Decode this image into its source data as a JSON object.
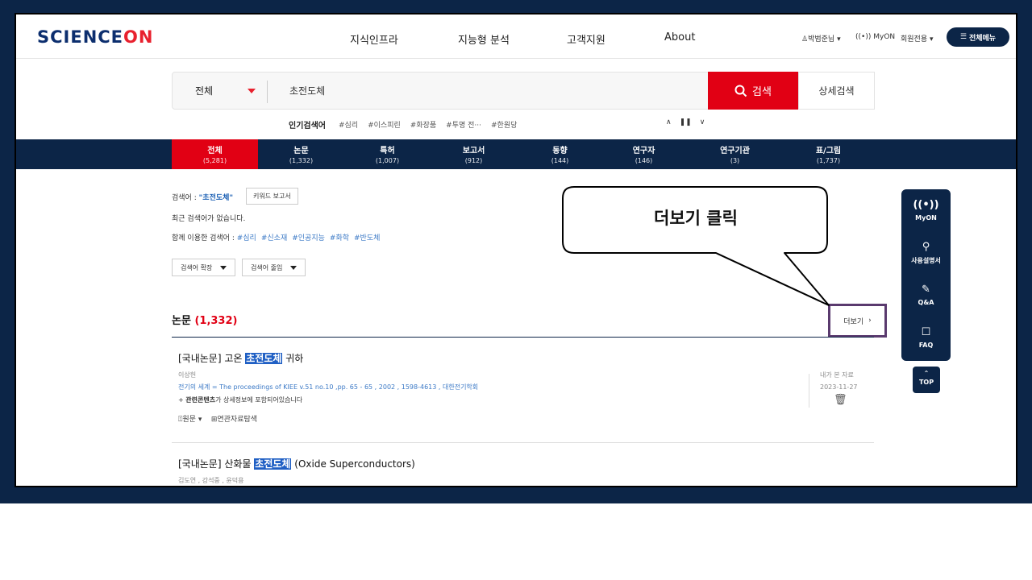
{
  "header": {
    "logo_main": "SCIENCE",
    "logo_accent": "ON",
    "nav": [
      "지식인프라",
      "지능형 분석",
      "고객지원",
      "About"
    ],
    "user": "박범준님",
    "myon": "MyON",
    "member": "회원전용",
    "menu_label": "전체메뉴"
  },
  "search": {
    "scope": "전체",
    "query": "초전도체",
    "search_label": "검색",
    "advanced_label": "상세검색"
  },
  "popular": {
    "label": "인기검색어",
    "items": [
      "#심리",
      "#이스피린",
      "#화장품",
      "#투명 전···",
      "#한원당"
    ],
    "controls": [
      "∧",
      "❚❚",
      "∨"
    ]
  },
  "tabs": [
    {
      "label": "전체",
      "count": "(5,281)"
    },
    {
      "label": "논문",
      "count": "(1,332)"
    },
    {
      "label": "특허",
      "count": "(1,007)"
    },
    {
      "label": "보고서",
      "count": "(912)"
    },
    {
      "label": "동향",
      "count": "(144)"
    },
    {
      "label": "연구자",
      "count": "(146)"
    },
    {
      "label": "연구기관",
      "count": "(3)"
    },
    {
      "label": "표/그림",
      "count": "(1,737)"
    }
  ],
  "info": {
    "keyword_label": "검색어 :",
    "keyword": "\"초전도체\"",
    "keyword_report": "키워드 보고서",
    "recent": "최근 검색어가 없습니다.",
    "related_label": "함께 이용한 검색어 :",
    "related": [
      "#심리",
      "#신소재",
      "#인공지능",
      "#화학",
      "#반도체"
    ],
    "expand": "검색어 확장",
    "narrow": "검색어 줄임"
  },
  "section": {
    "title": "논문",
    "count": "(1,332)",
    "more": "더보기"
  },
  "results": [
    {
      "prefix": "[국내논문] 고온",
      "highlight": "초전도체",
      "suffix": "귀하",
      "author": "이상헌",
      "source": "전기의 세계 = The proceedings of KIEE v.51 no.10 ,pp. 65 - 65 , 2002 , 1598-4613 , 대한전기학회",
      "related_bold": "관련콘텐츠",
      "related_text": "가 상세정보에 포함되어있습니다",
      "original": "원문",
      "explore": "연관자료탐색",
      "viewed_label": "내가 본 자료",
      "viewed_date": "2023-11-27"
    },
    {
      "prefix": "[국내논문] 산화물",
      "highlight": "초전도체",
      "suffix": "(Oxide Superconductors)",
      "author": "김도연 , 강석중 , 윤덕용"
    }
  ],
  "quick_menu": {
    "items": [
      {
        "icon": "((•))",
        "label": "MyON"
      },
      {
        "icon": "⚲",
        "label": "사용설명서"
      },
      {
        "icon": "✎",
        "label": "Q&A"
      },
      {
        "icon": "☐",
        "label": "FAQ"
      }
    ],
    "top": "TOP"
  },
  "callout": {
    "text": "더보기 클릭"
  }
}
